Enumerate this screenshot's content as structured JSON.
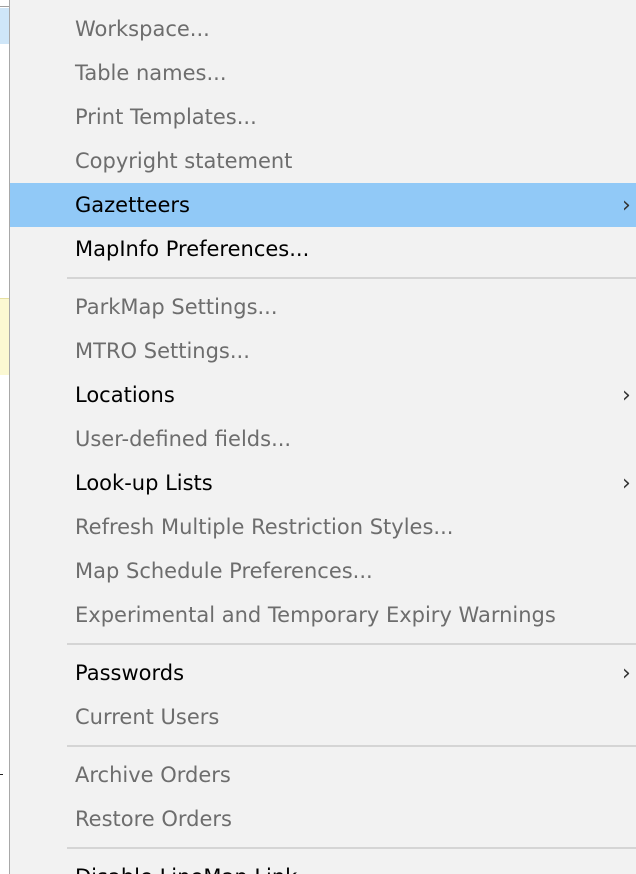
{
  "menu": {
    "items": [
      {
        "label": "Workspace...",
        "enabled": false
      },
      {
        "label": "Table names...",
        "enabled": false
      },
      {
        "label": "Print Templates...",
        "enabled": false
      },
      {
        "label": "Copyright statement",
        "enabled": false
      },
      {
        "label": "Gazetteers",
        "enabled": true,
        "submenu": true,
        "highlighted": true
      },
      {
        "label": "MapInfo Preferences...",
        "enabled": true
      },
      {
        "label": "ParkMap Settings...",
        "enabled": false
      },
      {
        "label": "MTRO Settings...",
        "enabled": false
      },
      {
        "label": "Locations",
        "enabled": true,
        "submenu": true
      },
      {
        "label": "User-defined fields...",
        "enabled": false
      },
      {
        "label": "Look-up Lists",
        "enabled": true,
        "submenu": true
      },
      {
        "label": "Refresh Multiple Restriction Styles...",
        "enabled": false
      },
      {
        "label": "Map Schedule Preferences...",
        "enabled": false
      },
      {
        "label": "Experimental and Temporary Expiry Warnings",
        "enabled": false
      },
      {
        "label": "Passwords",
        "enabled": true,
        "submenu": true
      },
      {
        "label": "Current Users",
        "enabled": false
      },
      {
        "label": "Archive Orders",
        "enabled": false
      },
      {
        "label": "Restore Orders",
        "enabled": false
      },
      {
        "label": "Disable LineMap Link",
        "enabled": true
      }
    ],
    "submenu_arrow": "›",
    "colors": {
      "highlight": "#91c9f7",
      "disabled_text": "#6d6d6d",
      "enabled_text": "#000000",
      "background": "#f2f2f2"
    }
  }
}
